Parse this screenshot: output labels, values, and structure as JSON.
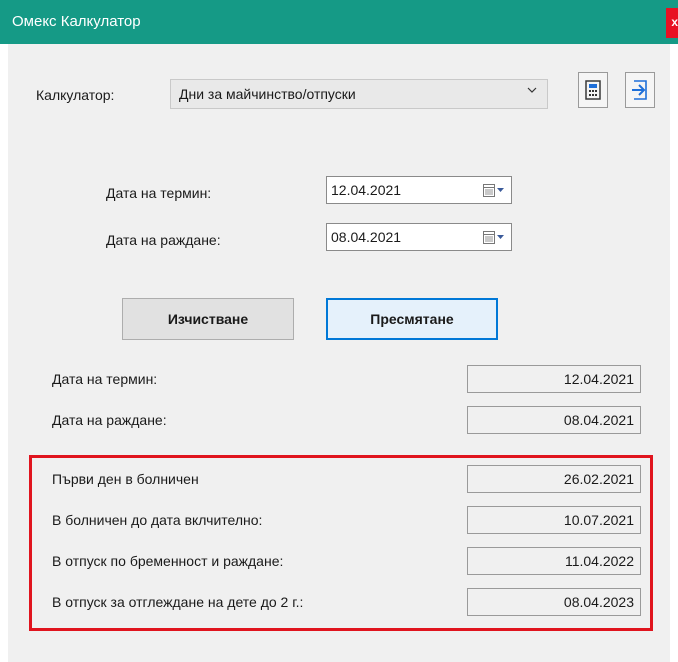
{
  "window": {
    "title": "Омекс Калкулатор",
    "close_label": "x"
  },
  "calculator": {
    "label": "Калкулатор:",
    "selected": "Дни за майчинство/отпуски",
    "calc_icon": "calculator-icon",
    "exit_icon": "exit-arrow-icon"
  },
  "inputs": {
    "term_label": "Дата на термин:",
    "term_value": "12.04.2021",
    "birth_label": "Дата на раждане:",
    "birth_value": "08.04.2021"
  },
  "buttons": {
    "clear": "Изчистване",
    "calculate": "Пресмятане"
  },
  "results": {
    "term_label": "Дата на термин:",
    "term_value": "12.04.2021",
    "birth_label": "Дата на раждане:",
    "birth_value": "08.04.2021",
    "sick_first_label": "Първи ден в болничен",
    "sick_first_value": "26.02.2021",
    "sick_until_label": "В болничен до дата вклчително:",
    "sick_until_value": "10.07.2021",
    "maternity_label": "В отпуск по бременност и раждане:",
    "maternity_value": "11.04.2022",
    "childcare_label": "В отпуск за отглеждане на дете до 2 г.:",
    "childcare_value": "08.04.2023"
  },
  "colors": {
    "titlebar": "#159a86",
    "highlight": "#e0141e",
    "primary_border": "#0078d7"
  }
}
